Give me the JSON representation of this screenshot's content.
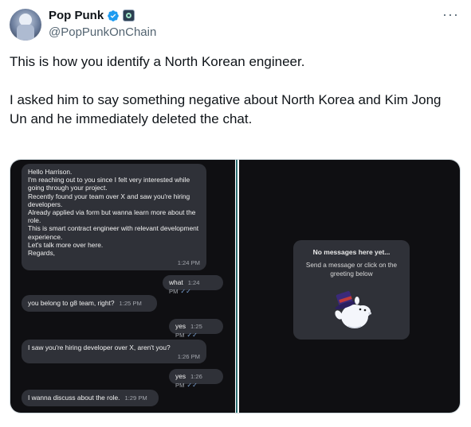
{
  "author": {
    "display_name": "Pop Punk",
    "handle": "@PopPunkOnChain",
    "verified_icon": "verified-badge-icon",
    "org_badge_icon": "org-badge-icon",
    "more_label": "···"
  },
  "tweet": {
    "paragraph_1": "This is how you identify a North Korean engineer.",
    "paragraph_2": "I asked him to say something negative about North Korea and Kim Jong Un and he immediately deleted the chat."
  },
  "chat": {
    "messages": [
      {
        "lines": [
          "Hello Harrison.",
          "I'm reaching out to you since I felt very interested while going through your project.",
          "Recently found your team over X and saw you're hiring developers.",
          "Already applied via form but wanna learn more about the role.",
          "This is smart contract engineer with relevant development experience.",
          "Let's talk more over here.",
          "Regards,"
        ],
        "time": "1:24 PM"
      },
      {
        "text": "what",
        "time": "1:24 PM",
        "ticks": "✓✓"
      },
      {
        "text": "you belong to g8 team, right?",
        "time": "1:25 PM"
      },
      {
        "text": "yes",
        "time": "1:25 PM",
        "ticks": "✓✓"
      },
      {
        "text": "I saw you're hiring developer over X, aren't you?",
        "time": "1:26 PM"
      },
      {
        "text": "yes",
        "time": "1:26 PM",
        "ticks": "✓✓"
      },
      {
        "text": "I wanna discuss about the role.",
        "time": "1:29 PM"
      }
    ],
    "empty_state": {
      "title": "No messages here yet...",
      "subtitle": "Send a message or click on the greeting below",
      "sticker_icon": "moomin-top-hat-sticker-icon"
    }
  },
  "colors": {
    "chat_bg": "#0f0f12",
    "bubble_bg": "#2f3138",
    "divider": "#2d6f73",
    "handle_gray": "#536471",
    "verified_blue": "#1d9bf0"
  }
}
